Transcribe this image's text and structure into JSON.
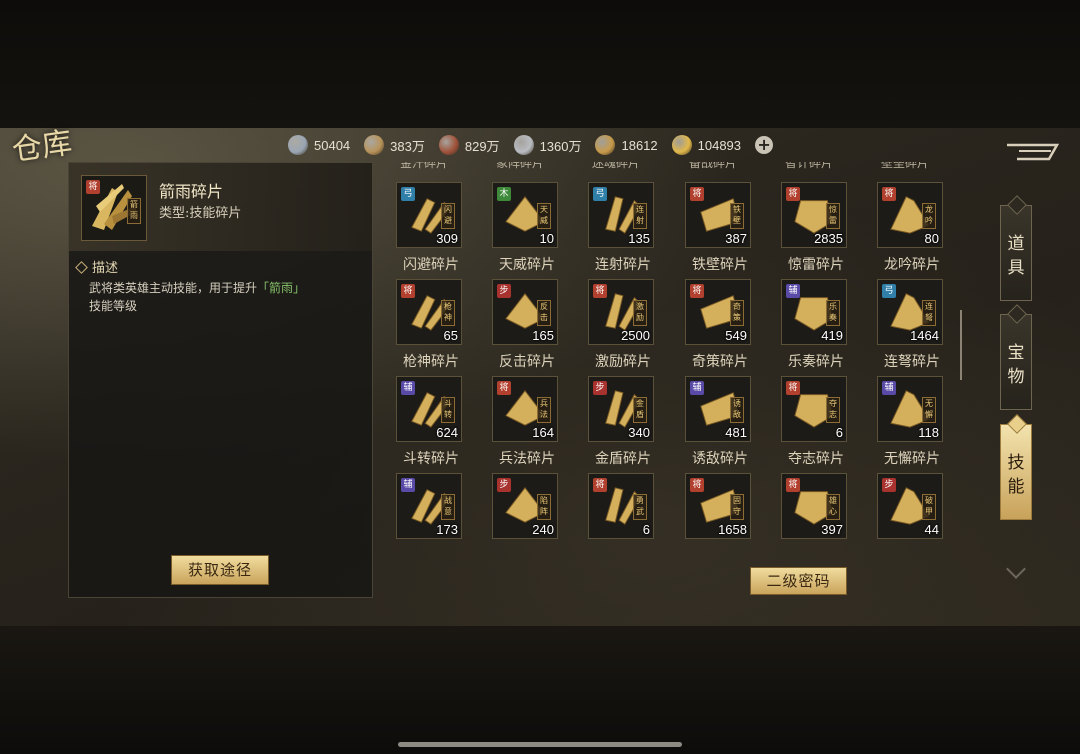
{
  "title": "仓库",
  "resources": [
    {
      "icon": "silver-coin-icon",
      "value": "50404",
      "color": "#9aa6b4"
    },
    {
      "icon": "grain-icon",
      "value": "383万",
      "color": "#b8935a"
    },
    {
      "icon": "wood-icon",
      "value": "829万",
      "color": "#a0523a"
    },
    {
      "icon": "iron-icon",
      "value": "1360万",
      "color": "#b9bcc2"
    },
    {
      "icon": "copper-coin-icon",
      "value": "18612",
      "color": "#c79a4a"
    },
    {
      "icon": "gold-ingot-icon",
      "value": "104893",
      "color": "#e2b84a"
    }
  ],
  "selected": {
    "name": "箭雨碎片",
    "type": "类型:技能碎片",
    "tag": "将",
    "seal": "箭雨",
    "desc_label": "描述",
    "desc_pre": "武将类英雄主动技能，用于提升",
    "desc_hl": "「箭雨」",
    "desc_post": "技能等级",
    "get_button": "获取途径"
  },
  "top_row": [
    "金汗碎片",
    "象阵碎片",
    "迷魂碎片",
    "备战碎片",
    "智计碎片",
    "壁垒碎片"
  ],
  "items": [
    {
      "name": "闪避碎片",
      "count": "309",
      "tag": "弓",
      "seal": "闪避"
    },
    {
      "name": "天威碎片",
      "count": "10",
      "tag": "木",
      "seal": "天威"
    },
    {
      "name": "连射碎片",
      "count": "135",
      "tag": "弓",
      "seal": "连射"
    },
    {
      "name": "铁壁碎片",
      "count": "387",
      "tag": "将",
      "seal": "铁壁"
    },
    {
      "name": "惊雷碎片",
      "count": "2835",
      "tag": "将",
      "seal": "惊雷"
    },
    {
      "name": "龙吟碎片",
      "count": "80",
      "tag": "将",
      "seal": "龙吟"
    },
    {
      "name": "枪神碎片",
      "count": "65",
      "tag": "将",
      "seal": "枪神"
    },
    {
      "name": "反击碎片",
      "count": "165",
      "tag": "步",
      "seal": "反击"
    },
    {
      "name": "激励碎片",
      "count": "2500",
      "tag": "将",
      "seal": "激励"
    },
    {
      "name": "奇策碎片",
      "count": "549",
      "tag": "将",
      "seal": "奇策"
    },
    {
      "name": "乐奏碎片",
      "count": "419",
      "tag": "辅",
      "seal": "乐奏"
    },
    {
      "name": "连弩碎片",
      "count": "1464",
      "tag": "弓",
      "seal": "连弩"
    },
    {
      "name": "斗转碎片",
      "count": "624",
      "tag": "辅",
      "seal": "斗转"
    },
    {
      "name": "兵法碎片",
      "count": "164",
      "tag": "将",
      "seal": "兵法"
    },
    {
      "name": "金盾碎片",
      "count": "340",
      "tag": "步",
      "seal": "金盾"
    },
    {
      "name": "诱敌碎片",
      "count": "481",
      "tag": "辅",
      "seal": "诱敌"
    },
    {
      "name": "夺志碎片",
      "count": "6",
      "tag": "将",
      "seal": "夺志"
    },
    {
      "name": "无懈碎片",
      "count": "118",
      "tag": "辅",
      "seal": "无懈"
    },
    {
      "name": "",
      "count": "173",
      "tag": "辅",
      "seal": "战意"
    },
    {
      "name": "",
      "count": "240",
      "tag": "步",
      "seal": "陷阵"
    },
    {
      "name": "",
      "count": "6",
      "tag": "将",
      "seal": "勇武"
    },
    {
      "name": "",
      "count": "1658",
      "tag": "将",
      "seal": "固守"
    },
    {
      "name": "",
      "count": "397",
      "tag": "将",
      "seal": "雄心"
    },
    {
      "name": "",
      "count": "44",
      "tag": "步",
      "seal": "破甲"
    }
  ],
  "tag_colors": {
    "将": "#b2402e",
    "弓": "#2f7fa8",
    "木": "#3e8a3a",
    "步": "#a8322e",
    "辅": "#5a4aa8"
  },
  "tabs": [
    {
      "label": "道具",
      "active": false
    },
    {
      "label": "宝物",
      "active": false
    },
    {
      "label": "技能",
      "active": true
    }
  ],
  "password_button": "二级密码"
}
